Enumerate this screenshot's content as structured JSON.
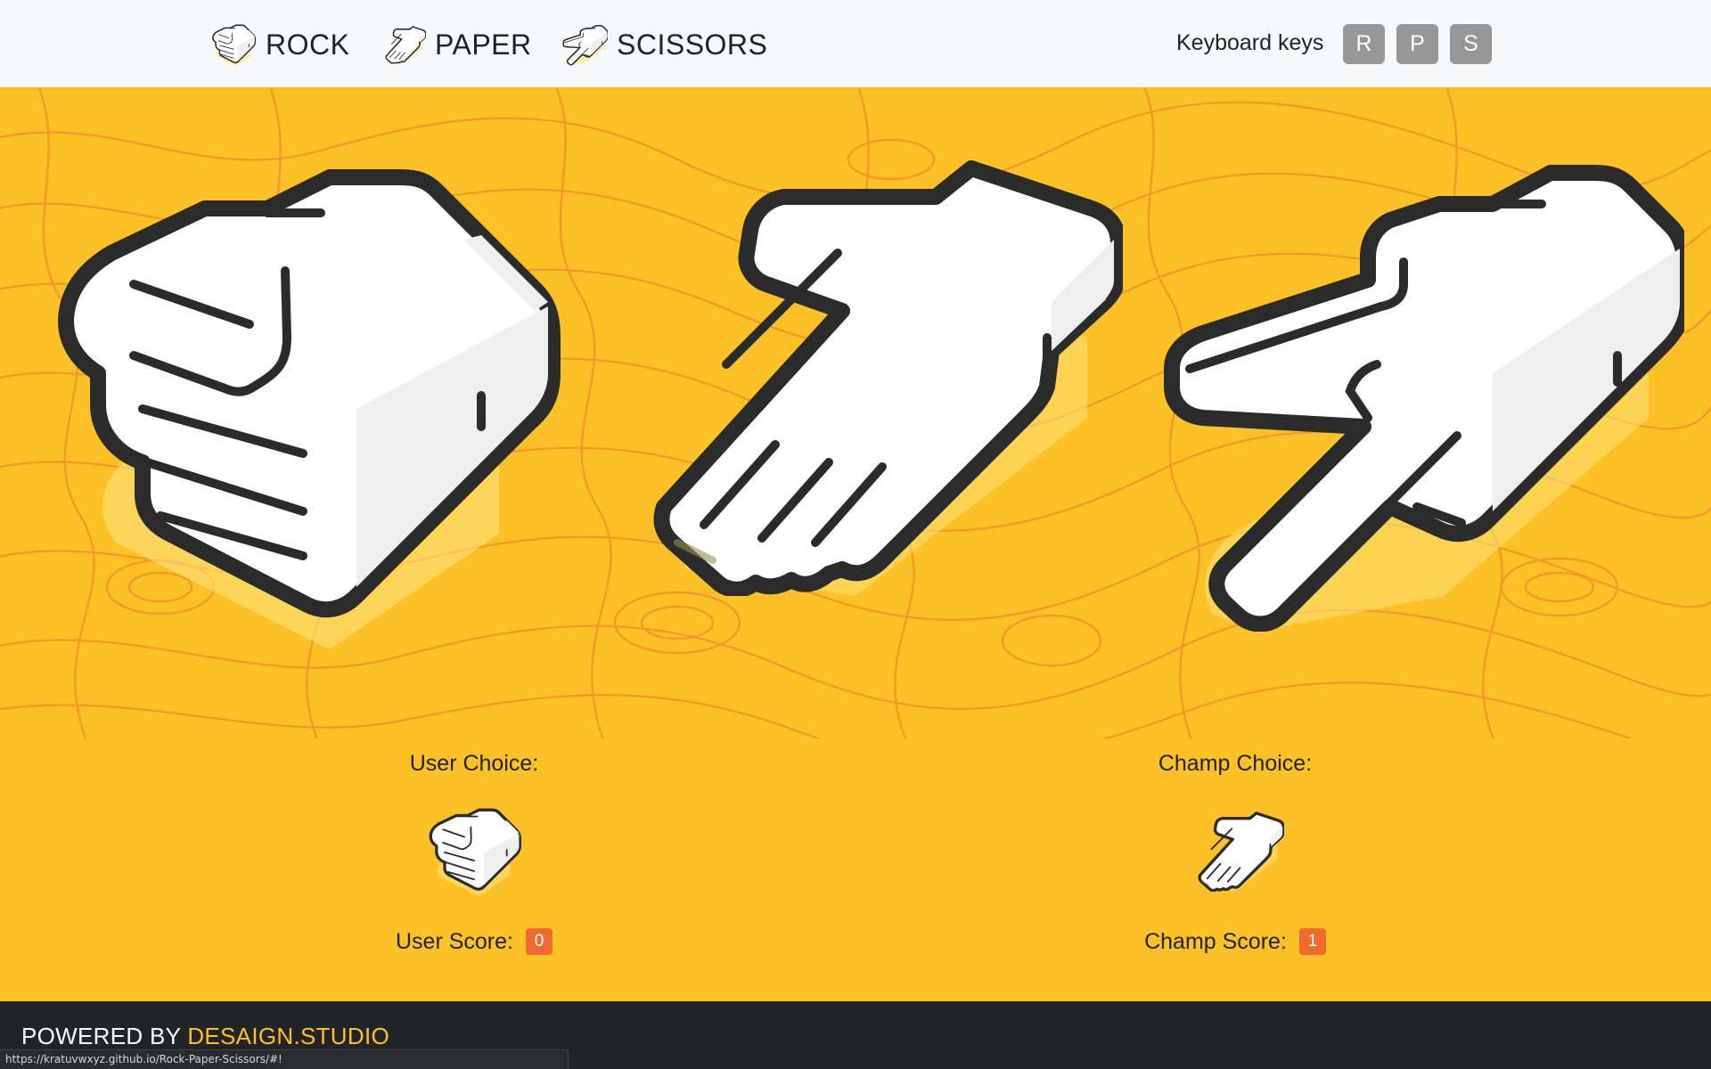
{
  "nav": {
    "items": [
      {
        "label": "ROCK",
        "icon": "rock-hand-icon"
      },
      {
        "label": "PAPER",
        "icon": "paper-hand-icon"
      },
      {
        "label": "SCISSORS",
        "icon": "scissors-hand-icon"
      }
    ],
    "keyboard_label": "Keyboard keys",
    "keys": [
      "R",
      "P",
      "S"
    ]
  },
  "arena": {
    "choices": [
      {
        "name": "rock",
        "icon": "rock-hand-icon"
      },
      {
        "name": "paper",
        "icon": "paper-hand-icon"
      },
      {
        "name": "scissors",
        "icon": "scissors-hand-icon"
      }
    ]
  },
  "results": {
    "user": {
      "title": "User Choice:",
      "choice_icon": "rock-hand-icon",
      "score_label": "User Score:",
      "score": "0"
    },
    "champ": {
      "title": "Champ Choice:",
      "choice_icon": "paper-hand-icon",
      "score_label": "Champ Score:",
      "score": "1"
    }
  },
  "footer": {
    "prefix": "POWERED BY ",
    "brand": "DESAIGN.STUDIO"
  },
  "status_url": "https://kratuvwxyz.github.io/Rock-Paper-Scissors/#!",
  "colors": {
    "background": "#fbc126",
    "topo_lines": "#f08a2a",
    "hand_outline": "#2b2b2b",
    "hand_fill": "#ffffff",
    "hand_shade": "#efefef",
    "score_badge": "#f06b32",
    "key_bg": "#979797",
    "footer_bg": "#232427",
    "brand": "#fbc126"
  }
}
